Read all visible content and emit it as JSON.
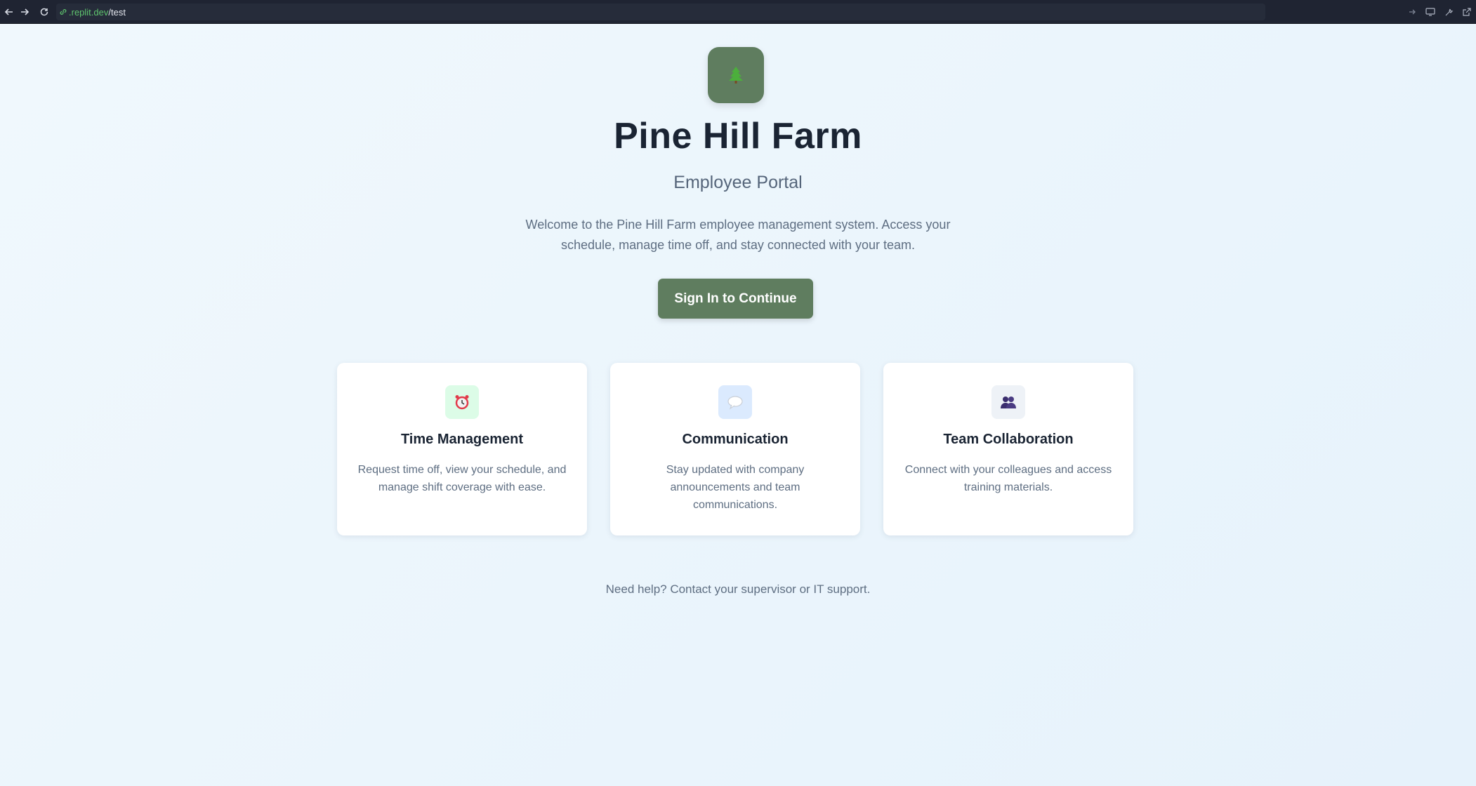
{
  "browser": {
    "back_icon": "arrow-left-icon",
    "forward_icon": "arrow-right-icon",
    "reload_icon": "reload-icon",
    "url_domain": ".replit.dev",
    "url_path": "/test",
    "right_icons": [
      "go-icon",
      "devices-icon",
      "tools-icon",
      "external-link-icon"
    ]
  },
  "hero": {
    "logo_icon": "pine-tree-icon",
    "title": "Pine Hill Farm",
    "subtitle": "Employee Portal",
    "intro": "Welcome to the Pine Hill Farm employee management system. Access your schedule, manage time off, and stay connected with your team.",
    "signin_label": "Sign In to Continue"
  },
  "features": [
    {
      "icon": "alarm-clock-icon",
      "icon_bg": "#dcfce7",
      "title": "Time Management",
      "description": "Request time off, view your schedule, and manage shift coverage with ease."
    },
    {
      "icon": "speech-bubble-icon",
      "icon_bg": "#dbeafe",
      "title": "Communication",
      "description": "Stay updated with company announcements and team communications."
    },
    {
      "icon": "team-icon",
      "icon_bg": "#eef2f7",
      "title": "Team Collaboration",
      "description": "Connect with your colleagues and access training materials."
    }
  ],
  "footer": {
    "help_text": "Need help? Contact your supervisor or IT support."
  },
  "colors": {
    "brand": "#5f7d5f",
    "page_bg": "#eaf4fb",
    "title": "#1a2433",
    "text": "#5e6e82"
  }
}
